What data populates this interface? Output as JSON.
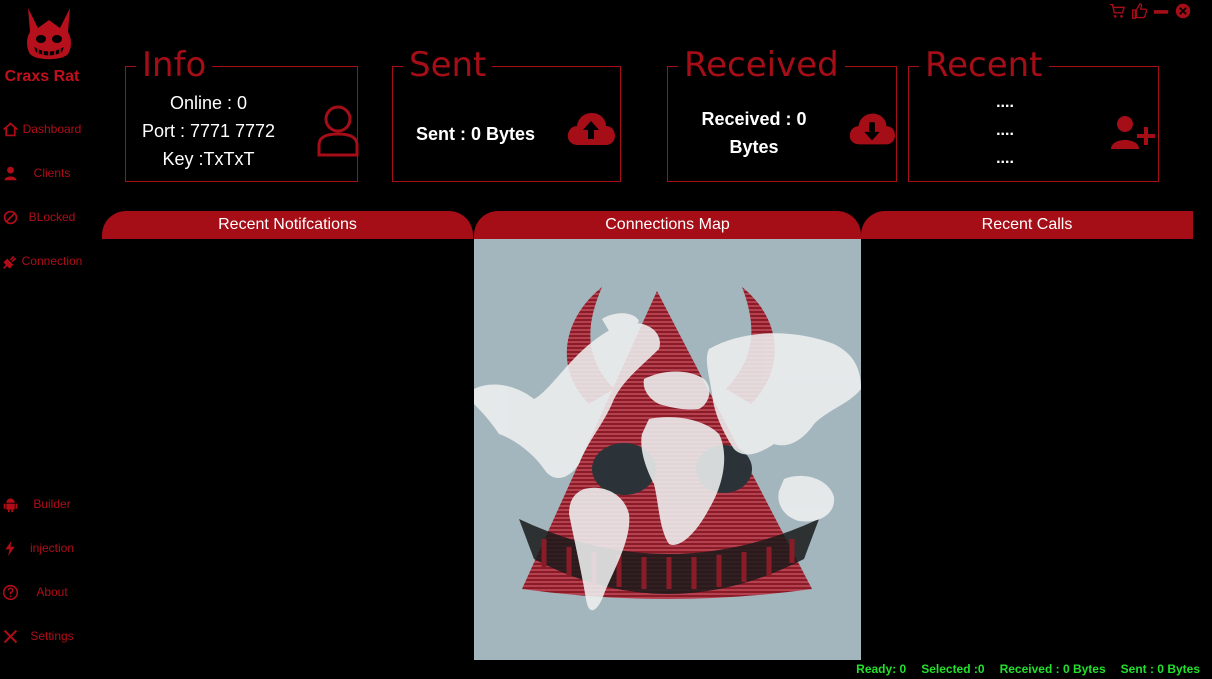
{
  "app": {
    "title": "Craxs Rat"
  },
  "window_controls": [
    {
      "icon": "cart-icon"
    },
    {
      "icon": "thumbs-up-icon"
    },
    {
      "icon": "minimize-icon"
    },
    {
      "icon": "close-icon"
    }
  ],
  "sidebar": {
    "items": [
      {
        "label": "Dashboard",
        "icon": "home-icon"
      },
      {
        "label": "Clients",
        "icon": "user-icon"
      },
      {
        "label": "BLocked",
        "icon": "blocked-icon"
      },
      {
        "label": "Connection",
        "icon": "plug-icon"
      },
      {
        "label": "Builder",
        "icon": "android-icon"
      },
      {
        "label": "injection",
        "icon": "bolt-icon"
      },
      {
        "label": "About",
        "icon": "question-icon"
      },
      {
        "label": "Settings",
        "icon": "tools-icon"
      }
    ]
  },
  "cards": {
    "info": {
      "title": "Info",
      "online": "Online : 0",
      "port": "Port : 7771 7772",
      "key": "Key :TxTxT",
      "icon": "user-outline-icon"
    },
    "sent": {
      "title": "Sent",
      "text": "Sent : 0 Bytes",
      "icon": "cloud-upload-icon"
    },
    "received": {
      "title": "Received",
      "line1": "Received : 0",
      "line2": "Bytes",
      "icon": "cloud-download-icon"
    },
    "recent": {
      "title": "Recent",
      "lines": [
        "....",
        "....",
        "...."
      ],
      "icon": "add-user-icon"
    }
  },
  "panels": {
    "notifications": "Recent Notifcations",
    "map": "Connections Map",
    "calls": "Recent Calls"
  },
  "status": {
    "ready": "Ready: 0",
    "selected": "Selected :0",
    "received": "Received : 0 Bytes",
    "sent": "Sent : 0 Bytes"
  },
  "colors": {
    "accent": "#a50d17",
    "status": "#22e02c",
    "map_bg": "#a4b6bd"
  }
}
